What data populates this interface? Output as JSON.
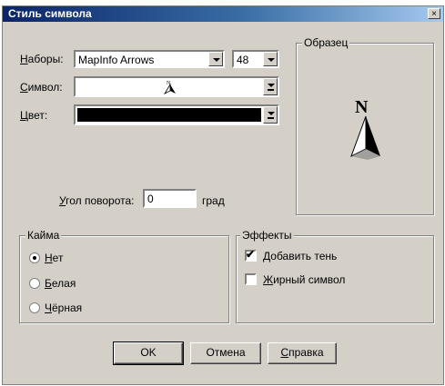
{
  "dialog": {
    "title": "Стиль символа",
    "close_glyph": "×"
  },
  "fields": {
    "sets_label_u": "Н",
    "sets_label_rest": "аборы:",
    "sets_value": "MapInfo Arrows",
    "size_value": "48",
    "symbol_label_u": "С",
    "symbol_label_rest": "имвол:",
    "symbol_glyph": "north-arrow-icon",
    "color_label_u": "Ц",
    "color_label_rest": "вет:",
    "color_value": "#000000",
    "rotation_label_u": "У",
    "rotation_label_rest": "гол поворота:",
    "rotation_value": "0",
    "rotation_unit": "град"
  },
  "preview": {
    "title": "Образец",
    "north_letter": "N"
  },
  "border_group": {
    "title": "Кайма",
    "options": [
      {
        "u": "Н",
        "rest": "ет",
        "selected": true
      },
      {
        "u": "Б",
        "rest": "елая",
        "selected": false
      },
      {
        "u": "Ч",
        "rest": "ёрная",
        "selected": false
      }
    ]
  },
  "effects_group": {
    "title": "Эффекты",
    "options": [
      {
        "u": "Д",
        "rest": "обавить тень",
        "checked": true
      },
      {
        "u": "Ж",
        "rest": "ирный символ",
        "checked": false
      }
    ]
  },
  "buttons": {
    "ok": "OK",
    "cancel": "Отмена",
    "help_u": "С",
    "help_rest": "правка"
  },
  "colors": {
    "dialog_bg": "#d4d0c8",
    "titlebar": "#0a246a"
  }
}
